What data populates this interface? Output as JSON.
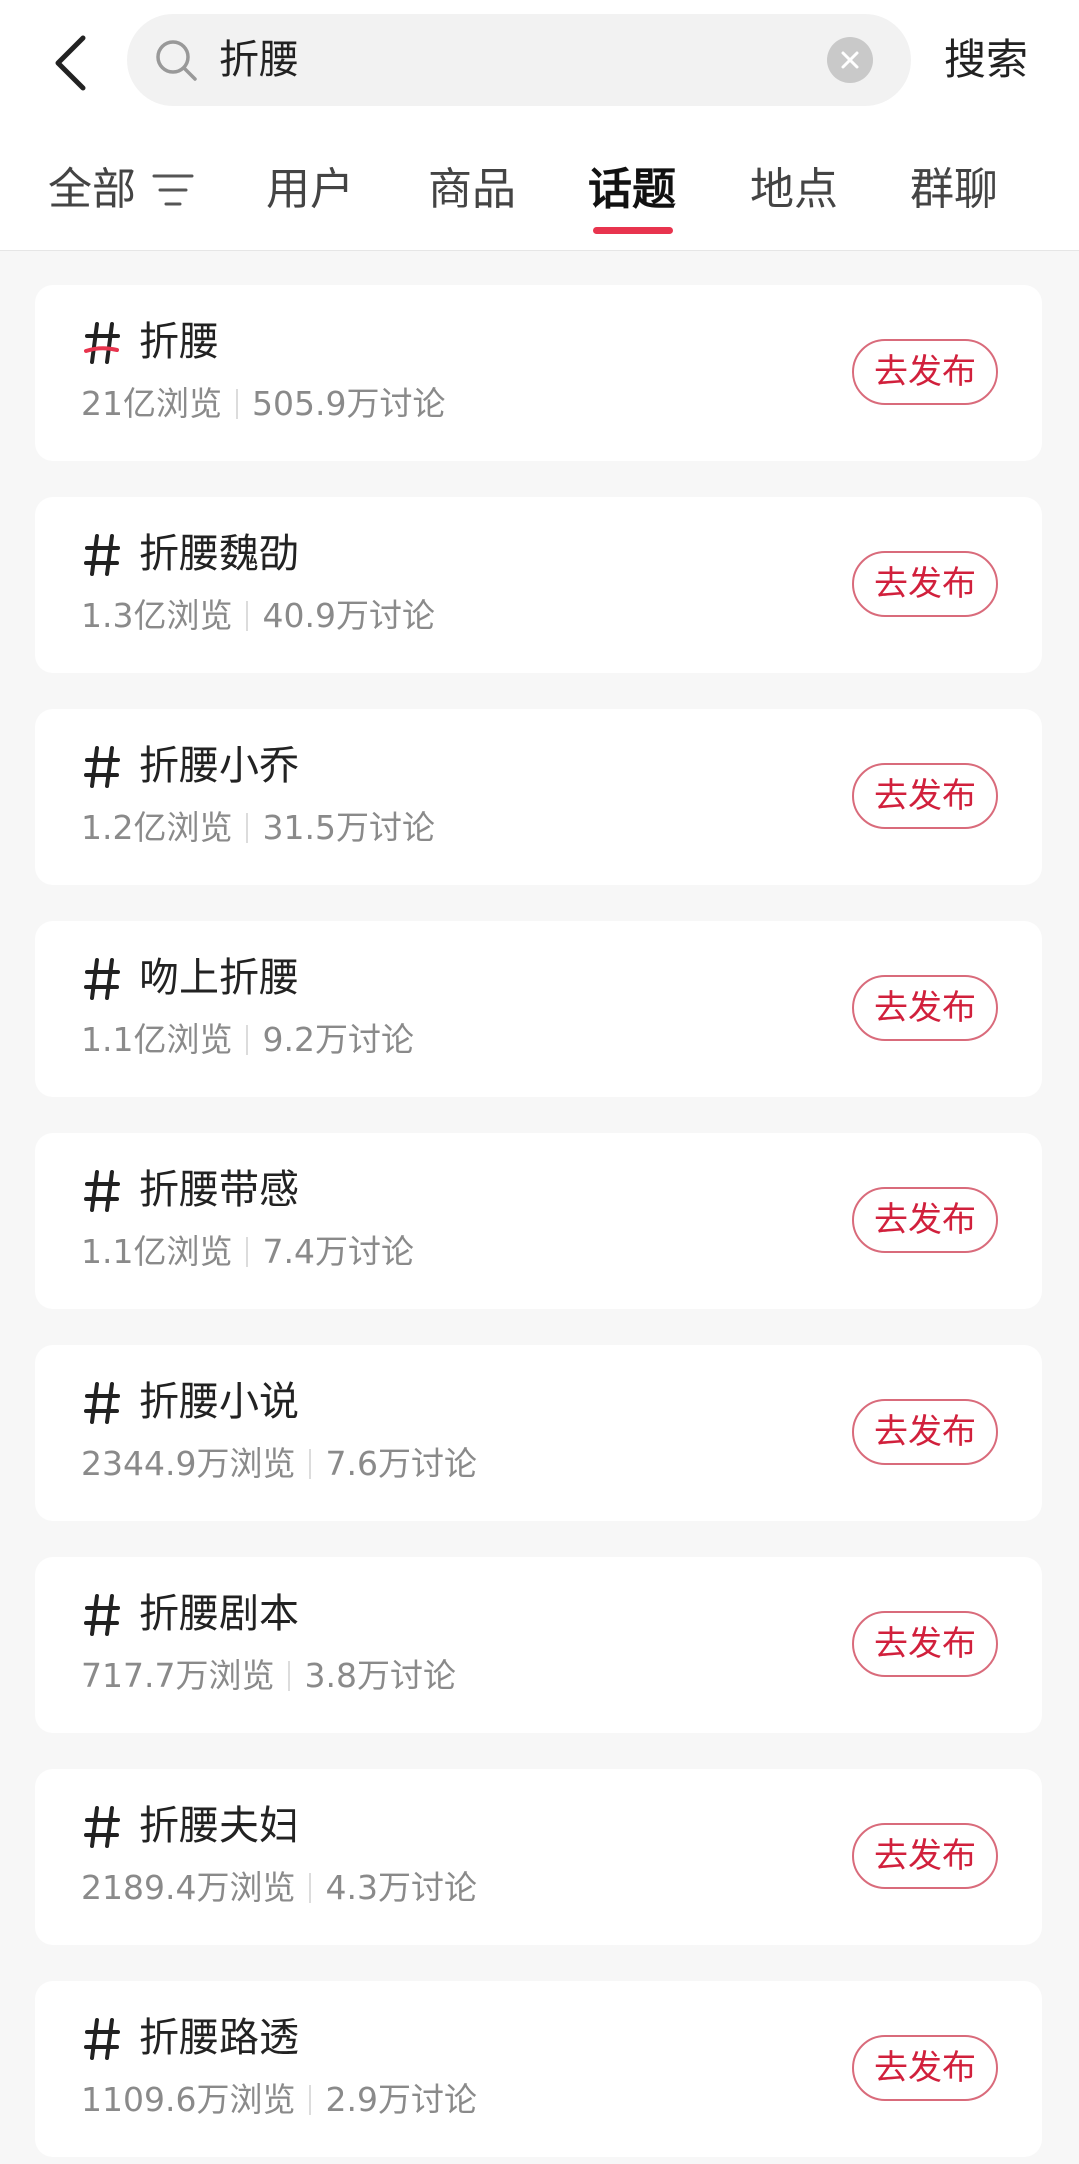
{
  "search": {
    "query": "折腰",
    "submit_label": "搜索"
  },
  "tabs": [
    {
      "label": "全部"
    },
    {
      "label": "用户"
    },
    {
      "label": "商品"
    },
    {
      "label": "话题"
    },
    {
      "label": "地点"
    },
    {
      "label": "群聊"
    }
  ],
  "active_tab": "话题",
  "accent_color": "#e8344e",
  "topics": [
    {
      "title": "折腰",
      "views": "21亿浏览",
      "discussions": "505.9万讨论",
      "action": "去发布"
    },
    {
      "title": "折腰魏劭",
      "views": "1.3亿浏览",
      "discussions": "40.9万讨论",
      "action": "去发布"
    },
    {
      "title": "折腰小乔",
      "views": "1.2亿浏览",
      "discussions": "31.5万讨论",
      "action": "去发布"
    },
    {
      "title": "吻上折腰",
      "views": "1.1亿浏览",
      "discussions": "9.2万讨论",
      "action": "去发布"
    },
    {
      "title": "折腰带感",
      "views": "1.1亿浏览",
      "discussions": "7.4万讨论",
      "action": "去发布"
    },
    {
      "title": "折腰小说",
      "views": "2344.9万浏览",
      "discussions": "7.6万讨论",
      "action": "去发布"
    },
    {
      "title": "折腰剧本",
      "views": "717.7万浏览",
      "discussions": "3.8万讨论",
      "action": "去发布"
    },
    {
      "title": "折腰夫妇",
      "views": "2189.4万浏览",
      "discussions": "4.3万讨论",
      "action": "去发布"
    },
    {
      "title": "折腰路透",
      "views": "1109.6万浏览",
      "discussions": "2.9万讨论",
      "action": "去发布"
    }
  ]
}
